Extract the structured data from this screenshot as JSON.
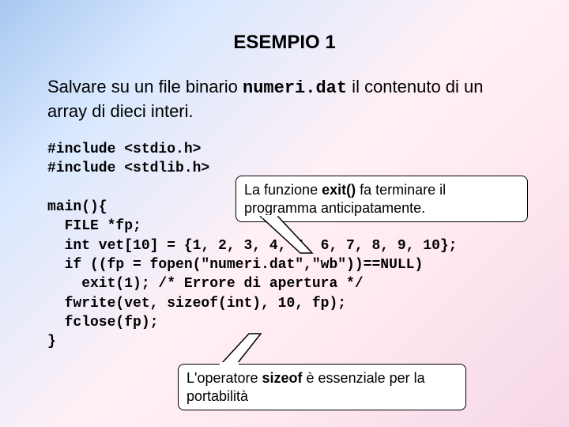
{
  "slide": {
    "title": "ESEMPIO 1",
    "desc_pre": "Salvare su un file binario ",
    "desc_file": "numeri.dat",
    "desc_post": " il contenuto di un array di dieci interi.",
    "code": "#include <stdio.h>\n#include <stdlib.h>\n\nmain(){\n  FILE *fp;\n  int vet[10] = {1, 2, 3, 4, 5, 6, 7, 8, 9, 10};\n  if ((fp = fopen(\"numeri.dat\",\"wb\"))==NULL)\n    exit(1); /* Errore di apertura */\n  fwrite(vet, sizeof(int), 10, fp);\n  fclose(fp);\n}",
    "callout1_pre": "La funzione ",
    "callout1_bold": "exit()",
    "callout1_post": " fa terminare il programma anticipatamente.",
    "callout2_pre": "L'operatore ",
    "callout2_bold": "sizeof",
    "callout2_post": " è essenziale per la portabilità"
  }
}
